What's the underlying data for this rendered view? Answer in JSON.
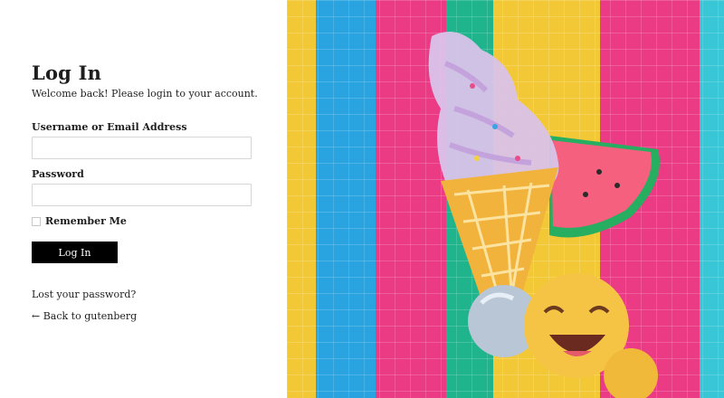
{
  "login": {
    "title": "Log In",
    "welcome": "Welcome back! Please login to your account.",
    "username_label": "Username or Email Address",
    "username_value": "",
    "password_label": "Password",
    "password_value": "",
    "remember_label": "Remember Me",
    "remember_checked": false,
    "submit_label": "Log In",
    "lost_password": "Lost your password?",
    "back_link": "← Back to gutenberg"
  },
  "colors": {
    "button_bg": "#000000",
    "button_text": "#ffffff",
    "stripe_yellow": "#f3c836",
    "stripe_blue": "#2aa4e0",
    "stripe_pink": "#ec3b85",
    "stripe_green": "#1fb48c",
    "stripe_cyan": "#39c6d6"
  },
  "image": {
    "description_icon": "balloons-photo"
  }
}
